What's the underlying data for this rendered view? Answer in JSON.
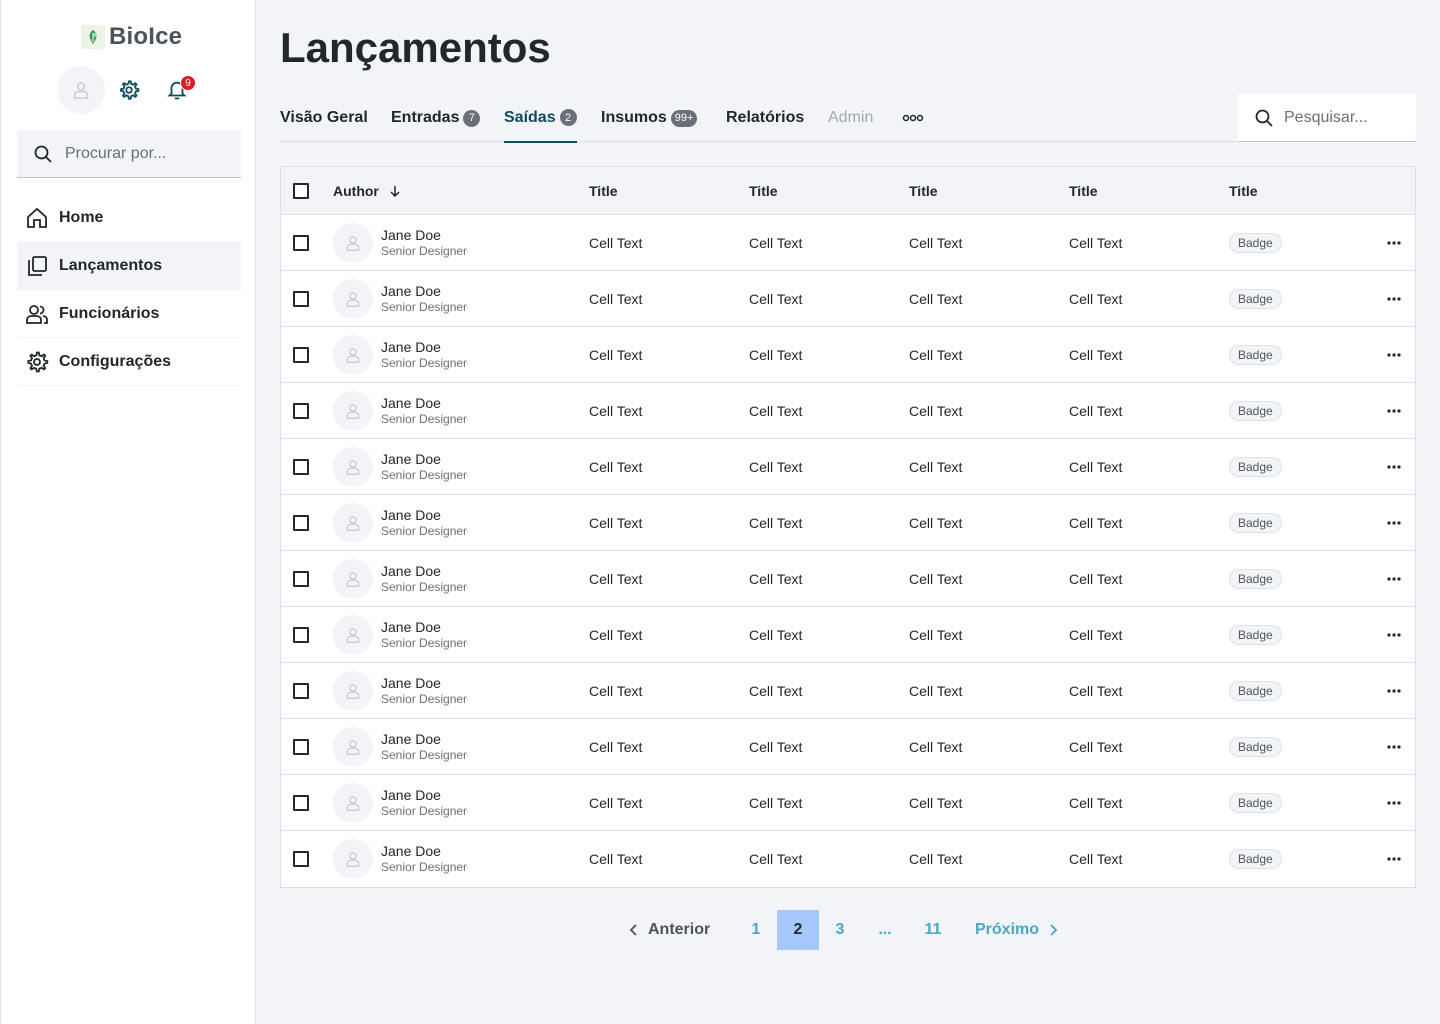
{
  "brand": {
    "name": "BioIce"
  },
  "sidebar": {
    "notifications_count": "9",
    "search_placeholder": "Procurar por...",
    "items": [
      {
        "label": "Home",
        "icon": "home-icon"
      },
      {
        "label": "Lançamentos",
        "icon": "copy-icon",
        "active": true
      },
      {
        "label": "Funcionários",
        "icon": "users-icon"
      },
      {
        "label": "Configurações",
        "icon": "gear-icon"
      }
    ]
  },
  "main": {
    "title": "Lançamentos",
    "tabs": [
      {
        "label": "Visão Geral"
      },
      {
        "label": "Entradas",
        "count": "7"
      },
      {
        "label": "Saídas",
        "count": "2",
        "active": true
      },
      {
        "label": "Insumos",
        "count": "99+"
      },
      {
        "label": "Relatórios"
      },
      {
        "label": "Admin",
        "disabled": true
      }
    ],
    "search_placeholder": "Pesquisar..."
  },
  "table": {
    "headers": [
      "Author",
      "Title",
      "Title",
      "Title",
      "Title",
      "Title"
    ],
    "rows": [
      {
        "name": "Jane Doe",
        "role": "Senior Designer",
        "cells": [
          "Cell Text",
          "Cell Text",
          "Cell Text",
          "Cell Text"
        ],
        "badge": "Badge"
      },
      {
        "name": "Jane Doe",
        "role": "Senior Designer",
        "cells": [
          "Cell Text",
          "Cell Text",
          "Cell Text",
          "Cell Text"
        ],
        "badge": "Badge"
      },
      {
        "name": "Jane Doe",
        "role": "Senior Designer",
        "cells": [
          "Cell Text",
          "Cell Text",
          "Cell Text",
          "Cell Text"
        ],
        "badge": "Badge"
      },
      {
        "name": "Jane Doe",
        "role": "Senior Designer",
        "cells": [
          "Cell Text",
          "Cell Text",
          "Cell Text",
          "Cell Text"
        ],
        "badge": "Badge"
      },
      {
        "name": "Jane Doe",
        "role": "Senior Designer",
        "cells": [
          "Cell Text",
          "Cell Text",
          "Cell Text",
          "Cell Text"
        ],
        "badge": "Badge"
      },
      {
        "name": "Jane Doe",
        "role": "Senior Designer",
        "cells": [
          "Cell Text",
          "Cell Text",
          "Cell Text",
          "Cell Text"
        ],
        "badge": "Badge"
      },
      {
        "name": "Jane Doe",
        "role": "Senior Designer",
        "cells": [
          "Cell Text",
          "Cell Text",
          "Cell Text",
          "Cell Text"
        ],
        "badge": "Badge"
      },
      {
        "name": "Jane Doe",
        "role": "Senior Designer",
        "cells": [
          "Cell Text",
          "Cell Text",
          "Cell Text",
          "Cell Text"
        ],
        "badge": "Badge"
      },
      {
        "name": "Jane Doe",
        "role": "Senior Designer",
        "cells": [
          "Cell Text",
          "Cell Text",
          "Cell Text",
          "Cell Text"
        ],
        "badge": "Badge"
      },
      {
        "name": "Jane Doe",
        "role": "Senior Designer",
        "cells": [
          "Cell Text",
          "Cell Text",
          "Cell Text",
          "Cell Text"
        ],
        "badge": "Badge"
      },
      {
        "name": "Jane Doe",
        "role": "Senior Designer",
        "cells": [
          "Cell Text",
          "Cell Text",
          "Cell Text",
          "Cell Text"
        ],
        "badge": "Badge"
      },
      {
        "name": "Jane Doe",
        "role": "Senior Designer",
        "cells": [
          "Cell Text",
          "Cell Text",
          "Cell Text",
          "Cell Text"
        ],
        "badge": "Badge"
      }
    ]
  },
  "pagination": {
    "prev_label": "Anterior",
    "next_label": "Próximo",
    "pages": [
      "1",
      "2",
      "3",
      "...",
      "11"
    ],
    "current": "2"
  },
  "colors": {
    "accent": "#0f4c5c",
    "link": "#4ba6c4",
    "current_page": "#a6c8ff",
    "notification": "#da1e28"
  }
}
